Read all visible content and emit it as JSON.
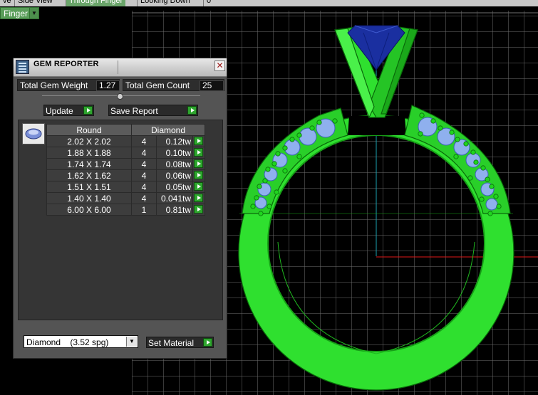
{
  "tabs": [
    "ve",
    "Side View",
    "Through Finger",
    "Looking Down",
    "0"
  ],
  "finger_select": {
    "value": "Finger"
  },
  "panel": {
    "title": "GEM REPORTER",
    "total_weight_label": "Total Gem Weight",
    "total_weight_value": "1.27",
    "total_count_label": "Total Gem Count",
    "total_count_value": "25",
    "update_label": "Update",
    "save_label": "Save Report",
    "table_headers": [
      "Round",
      "Diamond"
    ],
    "rows": [
      {
        "size": "2.02 X 2.02",
        "count": "4",
        "weight": "0.12tw"
      },
      {
        "size": "1.88 X 1.88",
        "count": "4",
        "weight": "0.10tw"
      },
      {
        "size": "1.74 X 1.74",
        "count": "4",
        "weight": "0.08tw"
      },
      {
        "size": "1.62 X 1.62",
        "count": "4",
        "weight": "0.06tw"
      },
      {
        "size": "1.51 X 1.51",
        "count": "4",
        "weight": "0.05tw"
      },
      {
        "size": "1.40 X 1.40",
        "count": "4",
        "weight": "0.041tw"
      },
      {
        "size": "6.00 X 6.00",
        "count": "1",
        "weight": "0.81tw"
      }
    ],
    "material_value": "Diamond    (3.52 spg)",
    "set_material_label": "Set Material"
  },
  "colors": {
    "ring_green": "#2fe02f",
    "gem_blue": "#1a2fa0",
    "stone_light_blue": "#8fb0ee",
    "grid": "#6f6f6f",
    "axis_red": "#e01818",
    "axis_cyan": "#1aa0b0"
  },
  "icons": [
    "close-icon",
    "app-icon",
    "gem-icon",
    "play-arrow-icon",
    "dropdown-arrow-icon"
  ]
}
